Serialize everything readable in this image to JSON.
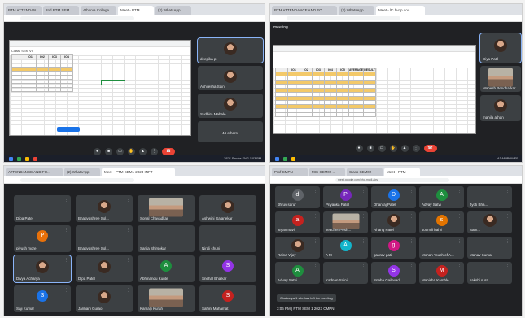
{
  "q1": {
    "tabs": [
      "PTM ATTENDAN...",
      "2nd PTM SEM...",
      "Atharva College",
      "Meet - PTM",
      "(2) WhatsApp"
    ],
    "sheet_title": "Class: SEM VI",
    "sheet_headers": [
      "",
      "IO1",
      "IO2",
      "IO3",
      "IO4"
    ],
    "side_tiles": [
      {
        "name": "deepika p"
      },
      {
        "name": "Akhilesha Saini"
      },
      {
        "name": "Sudhira Mahale"
      },
      {
        "name": "44 others"
      }
    ],
    "taskbar_text": "29°C  Smoke  ENG  1:03 PM"
  },
  "q2": {
    "tabs": [
      "PTM ATTENDANCE AND FO...",
      "(2) WhatsApp",
      "Meet - ltc bvdp doo"
    ],
    "meeting_label": "meeting",
    "sheet_headers": [
      "",
      "IO1",
      "IO2",
      "IO3",
      "IO4",
      "IO5",
      "AVERAGE",
      "RESULT"
    ],
    "side_tiles": [
      {
        "name": "Diya Patil"
      },
      {
        "name": "Mahesh Pendharkar"
      },
      {
        "name": "mahila athan"
      }
    ],
    "taskbar_text": "ADANIPOWER"
  },
  "q3": {
    "tabs": [
      "ATTENDANCE AND FO...",
      "(2) WhatsApp",
      "Meet - PTM SEM1 2023 INFT"
    ],
    "tiles": [
      {
        "name": "Dipa Patel",
        "kind": "blank"
      },
      {
        "name": "Bhagyashree Sol...",
        "kind": "photo"
      },
      {
        "name": "Sonal Chavadkar",
        "kind": "wide"
      },
      {
        "name": "Ashwini Gajanekar",
        "kind": "photo"
      },
      {
        "name": "piyush more",
        "kind": "avatar",
        "letter": "P",
        "color": "#e8710a"
      },
      {
        "name": "Bhagyashree Sol...",
        "kind": "blank"
      },
      {
        "name": "Sarita Shirsokar",
        "kind": "blank"
      },
      {
        "name": "Nirali chuni",
        "kind": "blank"
      },
      {
        "name": "Divya Acharya",
        "kind": "photo"
      },
      {
        "name": "Dipa Patel",
        "kind": "photo"
      },
      {
        "name": "Abhinandu Kunte",
        "kind": "avatar",
        "letter": "A",
        "color": "#1e8e3e"
      },
      {
        "name": "Snehal Bhalkar",
        "kind": "avatar",
        "letter": "S",
        "color": "#9334e6"
      },
      {
        "name": "Saji Kumar",
        "kind": "avatar",
        "letter": "S",
        "color": "#1a73e8"
      },
      {
        "name": "Jarihani Gurao",
        "kind": "photo"
      },
      {
        "name": "Kamalji Kurah",
        "kind": "wide"
      },
      {
        "name": "Sahini Mahamat",
        "kind": "avatar",
        "letter": "S",
        "color": "#c5221f"
      }
    ]
  },
  "q4": {
    "tabs": [
      "Prof CMPN",
      "MIS-SEM02 ...",
      "Class SEM02",
      "Meet - PTM"
    ],
    "url": "meet.google.com/bho-mcdl-ajez",
    "tiles": [
      {
        "name": "dhruv sarur",
        "kind": "avatar",
        "letter": "d",
        "color": "#5f6368"
      },
      {
        "name": "Priyanka Patel",
        "kind": "avatar",
        "letter": "P",
        "color": "#7627bb"
      },
      {
        "name": "Dhanraj Patel",
        "kind": "avatar",
        "letter": "D",
        "color": "#1a73e8"
      },
      {
        "name": "Advay Satvi",
        "kind": "avatar",
        "letter": "A",
        "color": "#1e8e3e"
      },
      {
        "name": "Jyoti Bha...",
        "kind": "blank"
      },
      {
        "name": "aryan navi",
        "kind": "avatar",
        "letter": "a",
        "color": "#c5221f"
      },
      {
        "name": "Teacher Pesh...",
        "kind": "wide"
      },
      {
        "name": "Rhang Patel",
        "kind": "photo"
      },
      {
        "name": "soumili bahri",
        "kind": "avatar",
        "letter": "s",
        "color": "#e37400"
      },
      {
        "name": "Sam...",
        "kind": "photo"
      },
      {
        "name": "Raina Vijay",
        "kind": "photo"
      },
      {
        "name": "A M",
        "kind": "avatar",
        "letter": "A",
        "color": "#12b5cb"
      },
      {
        "name": "gaurav patil",
        "kind": "avatar",
        "letter": "g",
        "color": "#d01884"
      },
      {
        "name": "Mohan Touch of A...",
        "kind": "blank"
      },
      {
        "name": "Manav Kumar",
        "kind": "blank"
      },
      {
        "name": "Advay Satvi",
        "kind": "avatar",
        "letter": "A",
        "color": "#1e8e3e"
      },
      {
        "name": "Kadnan Saini",
        "kind": "blank"
      },
      {
        "name": "Sneha Gaikwad",
        "kind": "avatar",
        "letter": "S",
        "color": "#9334e6"
      },
      {
        "name": "Manisha Kamble",
        "kind": "avatar",
        "letter": "M",
        "color": "#c5221f"
      },
      {
        "name": "sakshi sura...",
        "kind": "blank"
      }
    ],
    "toast": "Chaitanya 1 site has left the meeting",
    "bottom_text": "3:06 PM  |  PTM SEM 1 2023 CMPN"
  }
}
